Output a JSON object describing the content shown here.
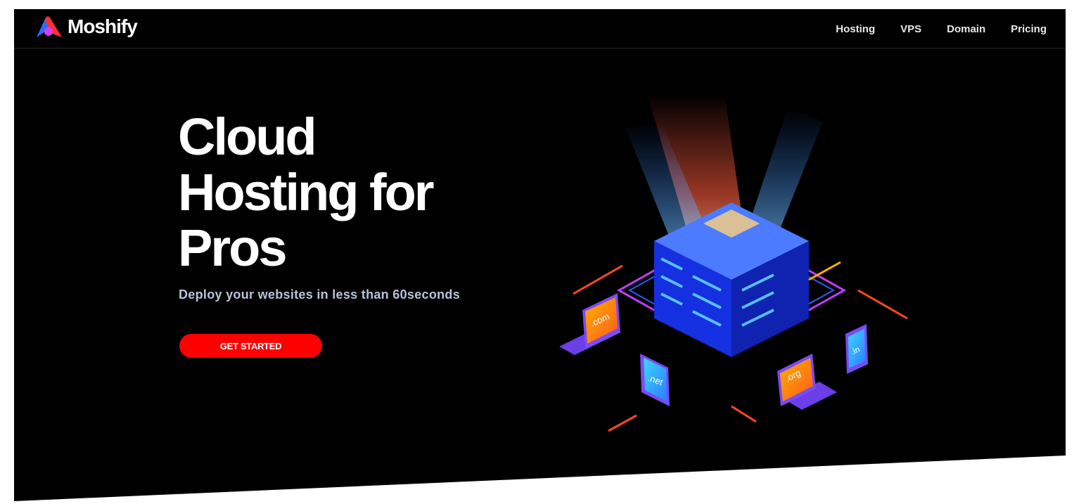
{
  "brand": {
    "name": "Moshify",
    "logo_icon": "moshify-logo-icon"
  },
  "nav": {
    "items": [
      {
        "label": "Hosting"
      },
      {
        "label": "VPS"
      },
      {
        "label": "Domain"
      },
      {
        "label": "Pricing"
      }
    ]
  },
  "hero": {
    "title_lines": [
      "Cloud",
      "Hosting for",
      "Pros"
    ],
    "subtitle": "Deploy your websites in less than 60seconds",
    "cta_label": "GET STARTED"
  },
  "illustration": {
    "icon": "server-cloud-illustration",
    "devices": [
      {
        "label": ".com",
        "icon": "laptop-icon"
      },
      {
        "label": ".net",
        "icon": "tablet-icon"
      },
      {
        "label": ".org",
        "icon": "laptop-icon"
      },
      {
        "label": ".in",
        "icon": "phone-icon"
      }
    ]
  },
  "colors": {
    "background": "#000000",
    "accent": "#ff0000",
    "subtitle": "#b8c3dc",
    "server": "#1530e0",
    "glow": "#ff5a3c"
  }
}
